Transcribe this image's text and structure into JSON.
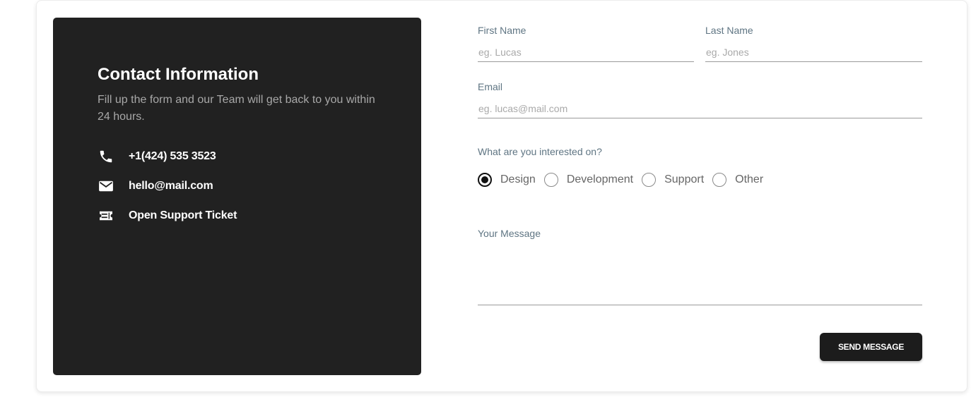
{
  "contact": {
    "title": "Contact Information",
    "description": "Fill up the form and our Team will get back to you within 24 hours.",
    "items": [
      {
        "icon": "phone-icon",
        "text": "+1(424) 535 3523"
      },
      {
        "icon": "mail-icon",
        "text": "hello@mail.com"
      },
      {
        "icon": "ticket-icon",
        "text": "Open Support Ticket"
      }
    ]
  },
  "form": {
    "first_name": {
      "label": "First Name",
      "placeholder": "eg. Lucas",
      "value": ""
    },
    "last_name": {
      "label": "Last Name",
      "placeholder": "eg. Jones",
      "value": ""
    },
    "email": {
      "label": "Email",
      "placeholder": "eg. lucas@mail.com",
      "value": ""
    },
    "interest": {
      "label": "What are you interested on?",
      "options": [
        "Design",
        "Development",
        "Support",
        "Other"
      ],
      "selected": "Design"
    },
    "message": {
      "label": "Your Message",
      "value": ""
    },
    "submit_label": "SEND MESSAGE"
  },
  "colors": {
    "panel_bg": "#212121",
    "label": "#5f7583",
    "button_bg": "#1c1c1c"
  }
}
